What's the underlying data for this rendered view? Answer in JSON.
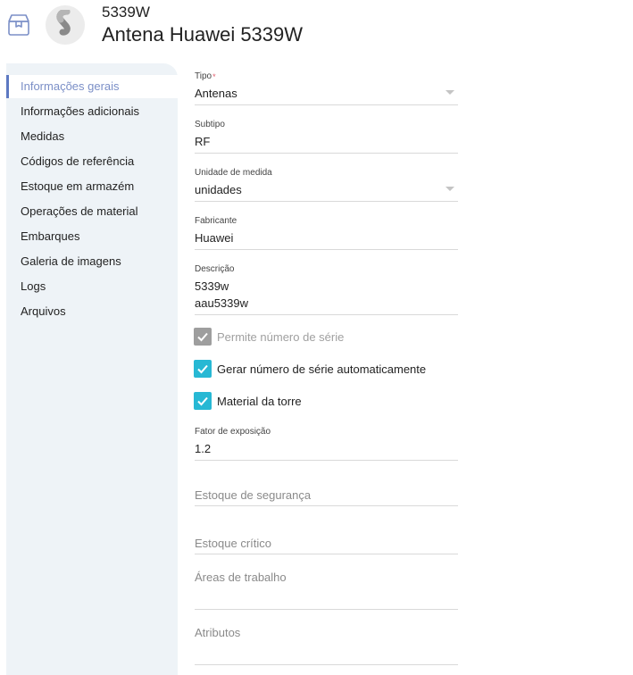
{
  "header": {
    "code": "5339W",
    "title": "Antena Huawei 5339W",
    "icon": "box-icon",
    "avatar_icon": "logo-icon"
  },
  "sidebar": {
    "items": [
      {
        "label": "Informações gerais",
        "active": true
      },
      {
        "label": "Informações adicionais"
      },
      {
        "label": "Medidas"
      },
      {
        "label": "Códigos de referência"
      },
      {
        "label": "Estoque em armazém"
      },
      {
        "label": "Operações de material"
      },
      {
        "label": "Embarques"
      },
      {
        "label": "Galeria de imagens"
      },
      {
        "label": "Logs"
      },
      {
        "label": "Arquivos"
      }
    ]
  },
  "form": {
    "tipo": {
      "label": "Tipo",
      "required_mark": "*",
      "value": "Antenas"
    },
    "subtipo": {
      "label": "Subtipo",
      "value": "RF"
    },
    "unidade": {
      "label": "Unidade de medida",
      "value": "unidades"
    },
    "fabricante": {
      "label": "Fabricante",
      "value": "Huawei"
    },
    "descricao": {
      "label": "Descrição",
      "lines": [
        "5339w",
        "aau5339w"
      ]
    },
    "checkboxes": {
      "serie": {
        "label": "Permite número de série",
        "checked": true,
        "disabled": true
      },
      "auto": {
        "label": "Gerar número de série automaticamente",
        "checked": true
      },
      "torre": {
        "label": "Material da torre",
        "checked": true
      }
    },
    "fator": {
      "label": "Fator de exposição",
      "value": "1.2"
    },
    "estoque_seguranca": {
      "placeholder": "Estoque de segurança"
    },
    "estoque_critico": {
      "placeholder": "Estoque crítico"
    },
    "areas": {
      "placeholder": "Áreas de trabalho"
    },
    "atributos": {
      "placeholder": "Atributos"
    }
  },
  "colors": {
    "accent": "#27b8d4",
    "active_nav": "#7b8fc7",
    "sidebar_bg": "#eef3f7",
    "required": "#e25b6b"
  }
}
